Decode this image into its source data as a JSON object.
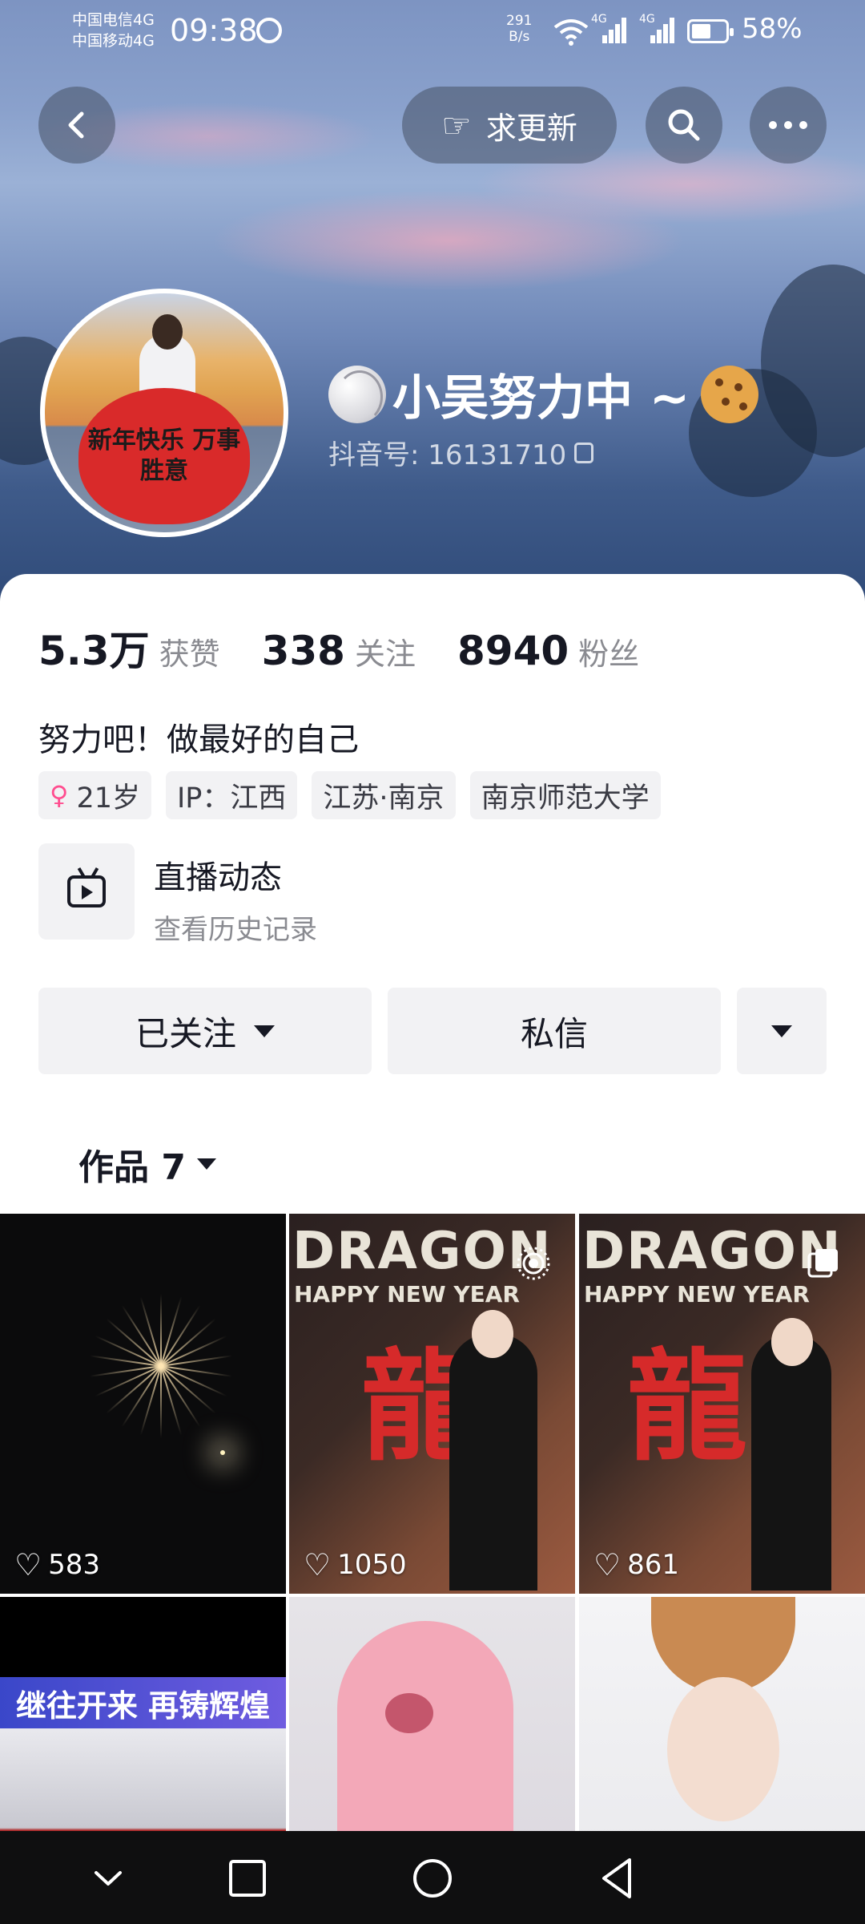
{
  "status_bar": {
    "carrier_1": "中国电信4G",
    "carrier_2": "中国移动4G",
    "time": "09:38",
    "speed_value": "291",
    "speed_unit": "B/s",
    "net_1": "4G",
    "net_2": "4G",
    "battery": "58%",
    "battery_level": 0.58
  },
  "header": {
    "request_update_label": "求更新"
  },
  "profile": {
    "avatar_text": "新年快乐 万事胜意",
    "name": "小吴努力中 ~",
    "douyin_id": "抖音号: 16131710",
    "stats": [
      {
        "value": "5.3万",
        "label": "获赞"
      },
      {
        "value": "338",
        "label": "关注"
      },
      {
        "value": "8940",
        "label": "粉丝"
      }
    ],
    "bio": "努力吧！做最好的自己",
    "tags": {
      "age": "21岁",
      "ip": "IP：江西",
      "location": "江苏·南京",
      "school": "南京师范大学"
    },
    "live": {
      "title": "直播动态",
      "subtitle": "查看历史记录"
    }
  },
  "actions": {
    "following_label": "已关注",
    "message_label": "私信"
  },
  "works": {
    "tab_label": "作品 7",
    "items": [
      {
        "likes": "583"
      },
      {
        "likes": "1050",
        "mural_word": "DRAGON",
        "mural_sub": "HAPPY NEW YEAR",
        "mural_text": "龍"
      },
      {
        "likes": "861",
        "mural_word": "DRAGON",
        "mural_sub": "HAPPY NEW YEAR",
        "mural_text": "龍"
      },
      {
        "banner_text": "继往开来 再铸辉煌"
      },
      {},
      {}
    ]
  },
  "colors": {
    "accent_pink": "#ff4d8f",
    "text_primary": "#161823",
    "text_secondary": "#8a8b91",
    "button_bg": "#f2f2f4"
  }
}
